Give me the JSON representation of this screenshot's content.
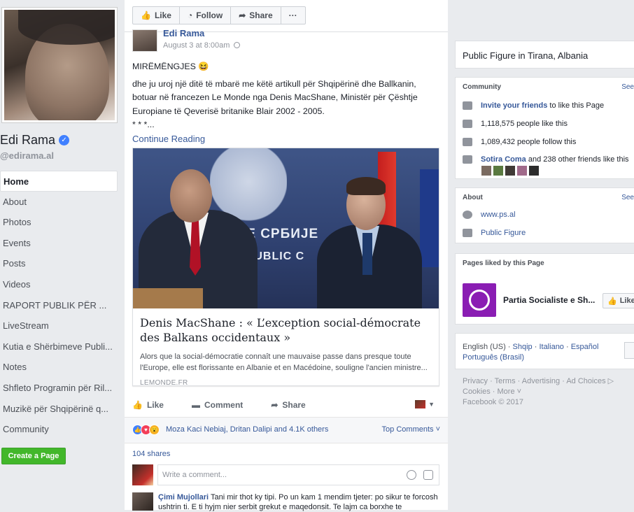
{
  "left": {
    "page_name": "Edi Rama",
    "handle": "@edirama.al",
    "nav": [
      "Home",
      "About",
      "Photos",
      "Events",
      "Posts",
      "Videos",
      "RAPORT PUBLIK PËR ...",
      "LiveStream",
      "Kutia e Shërbimeve Publi...",
      "Notes",
      "Shfleto Programin për Ril...",
      "Muzikë për Shqipërinë q...",
      "Community"
    ],
    "create_page": "Create a Page"
  },
  "actionbar": {
    "like": "Like",
    "follow": "Follow",
    "share": "Share",
    "more": "···"
  },
  "post": {
    "author": "Edi Rama",
    "time": "August 3 at 8:00am",
    "greeting": "MIRËMËNGJES 😆",
    "body": "dhe ju uroj një ditë të mbarë me këtë artikull për Shqipërinë dhe Ballkanin, botuar në francezen Le Monde nga Denis MacShane, Ministër për Çështje Europiane të Qeverisë britanike Blair 2002 - 2005.",
    "stars": "* * *...",
    "continue": "Continue Reading",
    "link": {
      "image_sign_1": "ИКЕ СРБИЈЕ",
      "image_sign_2": "EPUBLIC C",
      "title": "Denis MacShane : « L’exception social-démocrate des Balkans occidentaux »",
      "desc": "Alors que la social-démocratie connaît une mauvaise passe dans presque toute l'Europe, elle est florissante en Albanie et en Macédoine, souligne l'ancien ministre...",
      "source": "LEMONDE.FR"
    },
    "actions": {
      "like": "Like",
      "comment": "Comment",
      "share": "Share"
    },
    "reactions_text": "Moza Kaci Nebiaj, Dritan Dalipi and 4.1K others",
    "top_comments": "Top Comments ˅",
    "shares": "104 shares",
    "comment_placeholder": "Write a comment...",
    "first_comment": {
      "name": "Çimi Mujollari",
      "text": " Tani mir thot ky tipi. Po un kam 1 mendim tjeter: po sikur te forcosh ushtrin ti. E ti hyjm nier serbit grekut e maqedonsit. Te lajm ca borxhe te"
    }
  },
  "right": {
    "category": "Public Figure in Tirana, Albania",
    "community": {
      "head": "Community",
      "see": "See",
      "invite_link": "Invite your friends",
      "invite_rest": " to like this Page",
      "likes": "1,118,575 people like this",
      "follows": "1,089,432 people follow this",
      "friend_link": "Sotira Coma",
      "friend_rest": " and 238 other friends like this"
    },
    "about": {
      "head": "About",
      "see": "See",
      "website": "www.ps.al",
      "type": "Public Figure"
    },
    "liked": {
      "head": "Pages liked by this Page",
      "page": "Partia Socialiste e Sh...",
      "like": "Like"
    },
    "langs": [
      "English (US)",
      "Shqip",
      "Italiano",
      "Español",
      "Português (Brasil)"
    ],
    "footer_line1": "Privacy · Terms · Advertising · Ad Choices ▷",
    "footer_line2": "Cookies · More ˅",
    "footer_line3": "Facebook © 2017"
  },
  "colors": {
    "link": "#365899",
    "green": "#42b72a",
    "verified": "#4080ff",
    "brand_purple": "#8a1db3"
  }
}
